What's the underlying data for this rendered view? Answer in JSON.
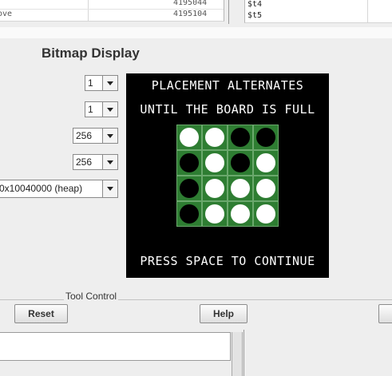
{
  "background": {
    "left_table": {
      "row1_value": "4195044",
      "row2_value": "4195104",
      "row2_label": "ove"
    },
    "right_table": {
      "row1_label": "$t4",
      "row2_label": "$t5"
    }
  },
  "dialog": {
    "title": "Bitmap Display",
    "settings": [
      {
        "name": "unit-width-select",
        "value": "1"
      },
      {
        "name": "unit-height-select",
        "value": "1"
      },
      {
        "name": "display-width-select",
        "value": "256"
      },
      {
        "name": "display-height-select",
        "value": "256"
      },
      {
        "name": "base-address-select",
        "value": "0x10040000 (heap)"
      }
    ],
    "display": {
      "line1": "PLACEMENT ALTERNATES",
      "line2": "UNTIL THE BOARD IS FULL",
      "line3": "PRESS SPACE TO CONTINUE",
      "board": [
        [
          "white",
          "white",
          "black",
          "black"
        ],
        [
          "black",
          "white",
          "black",
          "white"
        ],
        [
          "black",
          "white",
          "white",
          "white"
        ],
        [
          "black",
          "white",
          "white",
          "white"
        ]
      ]
    },
    "tool_control": {
      "label": "Tool Control",
      "reset_label": "Reset",
      "help_label": "Help"
    }
  },
  "colors": {
    "board_green": "#2e7d32",
    "display_bg": "#000000"
  }
}
